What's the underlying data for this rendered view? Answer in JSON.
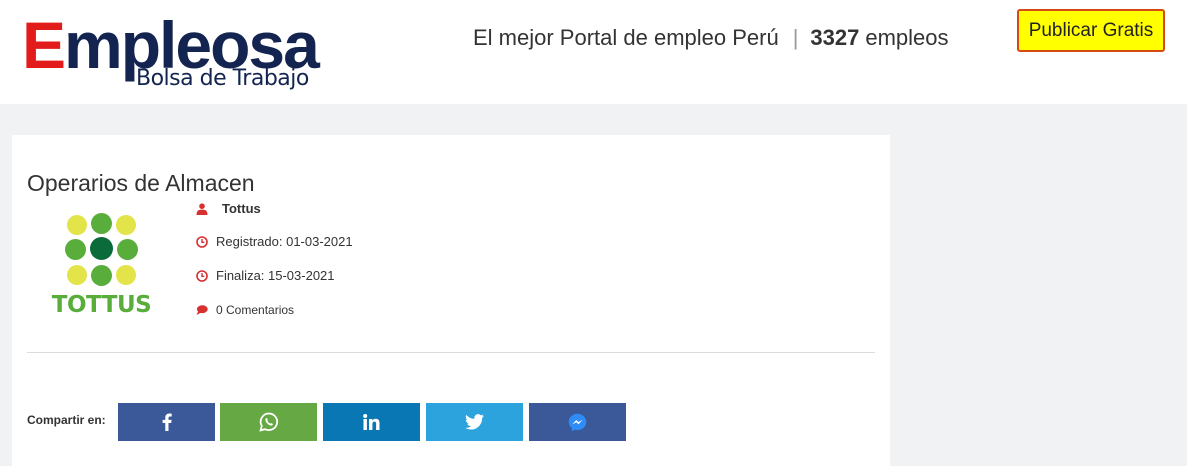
{
  "header": {
    "logo": {
      "first_letter": "E",
      "rest": "mpleosa",
      "subtitle": "Bolsa de Trabajo"
    },
    "tagline": "El mejor Portal de empleo Perú",
    "separator": "|",
    "job_count": "3327",
    "job_count_label": "empleos",
    "publish_button": "Publicar Gratis"
  },
  "job": {
    "title": "Operarios de Almacen",
    "company_logo_text": "TOTTUS",
    "company": "Tottus",
    "registered": "Registrado: 01-03-2021",
    "ends": "Finaliza: 15-03-2021",
    "comments": "0 Comentarios"
  },
  "share": {
    "label": "Compartir en:",
    "buttons": [
      {
        "network": "facebook",
        "icon": "facebook-icon",
        "color": "#3b5998"
      },
      {
        "network": "whatsapp",
        "icon": "whatsapp-icon",
        "color": "#65a844"
      },
      {
        "network": "linkedin",
        "icon": "linkedin-icon",
        "color": "#0a77b5"
      },
      {
        "network": "twitter",
        "icon": "twitter-icon",
        "color": "#2ca3dc"
      },
      {
        "network": "messenger",
        "icon": "messenger-icon",
        "color": "#3b5998"
      }
    ]
  },
  "colors": {
    "brand_navy": "#12244f",
    "brand_red": "#e21b1b",
    "publish_bg": "#ffff00",
    "publish_border": "#d44a12",
    "icon_red": "#d63031",
    "page_bg": "#f1f2f4"
  }
}
